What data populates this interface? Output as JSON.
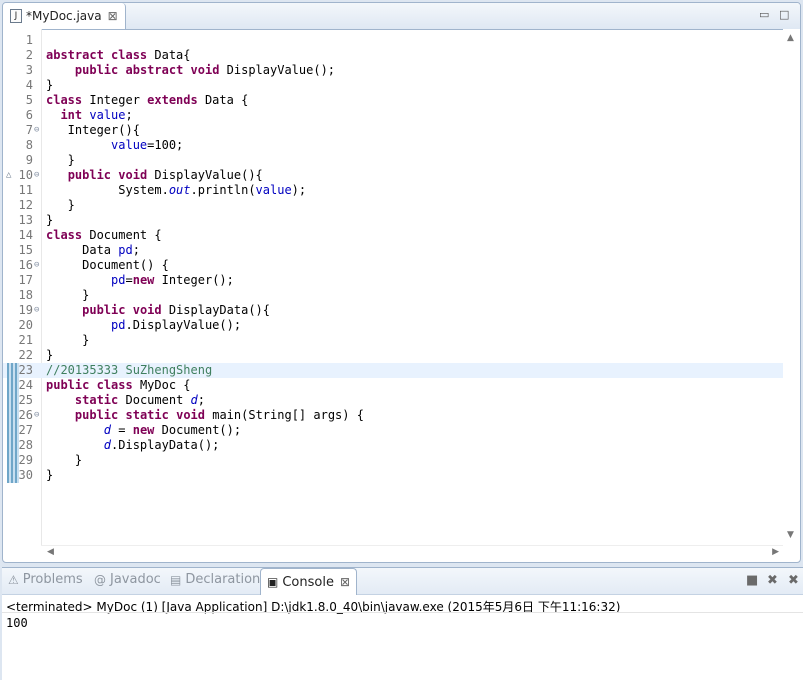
{
  "editor": {
    "tab_title": "*MyDoc.java",
    "tab_icon": "J",
    "close_glyph": "⊠",
    "minimize_glyph": "▭",
    "maximize_glyph": "□"
  },
  "code_lines": [
    {
      "n": "1",
      "t": ""
    },
    {
      "n": "2",
      "t": "abstract class Data{"
    },
    {
      "n": "3",
      "t": "    public abstract void DisplayValue();"
    },
    {
      "n": "4",
      "t": "}"
    },
    {
      "n": "5",
      "t": "class Integer extends Data {"
    },
    {
      "n": "6",
      "t": "  int value;"
    },
    {
      "n": "7",
      "t": "   Integer(){"
    },
    {
      "n": "8",
      "t": "         value=100;"
    },
    {
      "n": "9",
      "t": "   }"
    },
    {
      "n": "10",
      "t": "   public void DisplayValue(){"
    },
    {
      "n": "11",
      "t": "          System.out.println(value);"
    },
    {
      "n": "12",
      "t": "   }"
    },
    {
      "n": "13",
      "t": "}"
    },
    {
      "n": "14",
      "t": "class Document {"
    },
    {
      "n": "15",
      "t": "     Data pd;"
    },
    {
      "n": "16",
      "t": "     Document() {"
    },
    {
      "n": "17",
      "t": "         pd=new Integer();"
    },
    {
      "n": "18",
      "t": "     }"
    },
    {
      "n": "19",
      "t": "     public void DisplayData(){"
    },
    {
      "n": "20",
      "t": "         pd.DisplayValue();"
    },
    {
      "n": "21",
      "t": "     }"
    },
    {
      "n": "22",
      "t": "}"
    },
    {
      "n": "23",
      "t": "//20135333 SuZhengSheng"
    },
    {
      "n": "24",
      "t": "public class MyDoc {"
    },
    {
      "n": "25",
      "t": "    static Document d;"
    },
    {
      "n": "26",
      "t": "    public static void main(String[] args) {"
    },
    {
      "n": "27",
      "t": "        d = new Document();"
    },
    {
      "n": "28",
      "t": "        d.DisplayData();"
    },
    {
      "n": "29",
      "t": "    }"
    },
    {
      "n": "30",
      "t": "}"
    }
  ],
  "console": {
    "tabs": [
      {
        "label": "Problems",
        "icon": "⚠"
      },
      {
        "label": "Javadoc",
        "icon": "@"
      },
      {
        "label": "Declaration",
        "icon": "▤"
      },
      {
        "label": "Console",
        "icon": "▣"
      }
    ],
    "close_glyph": "⊠",
    "stop_glyph": "■",
    "remove_glyph": "✖",
    "remove_all_glyph": "✖",
    "status": "<terminated> MyDoc (1) [Java Application] D:\\jdk1.8.0_40\\bin\\javaw.exe (2015年5月6日 下午11:16:32)",
    "output": "100"
  },
  "colors": {
    "keyword": "#7f0055",
    "field": "#0000c0",
    "comment": "#3f7f5f",
    "current_line": "#e8f2fe"
  }
}
